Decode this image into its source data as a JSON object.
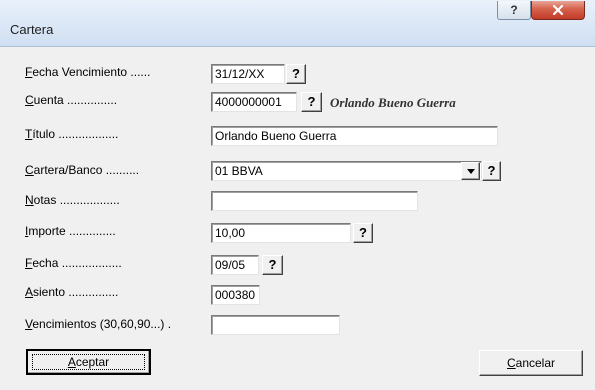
{
  "window": {
    "title": "Cartera",
    "help_glyph": "?",
    "close_glyph": "x"
  },
  "form": {
    "fecha_vencimiento": {
      "key": "F",
      "rest": "echa Vencimiento",
      "dots": " ......",
      "value": "31/12/XX"
    },
    "cuenta": {
      "key": "C",
      "rest": "uenta",
      "dots": " ...............",
      "value": "4000000001",
      "name": "Orlando Bueno Guerra"
    },
    "titulo": {
      "key": "T",
      "rest": "ítulo",
      "dots": " ..................",
      "value": "Orlando Bueno Guerra"
    },
    "cartera_banco": {
      "key": "C",
      "rest": "artera/Banco",
      "dots": " ..........",
      "value": "01 BBVA"
    },
    "notas": {
      "key": "N",
      "rest": "otas",
      "dots": " ..................",
      "value": ""
    },
    "importe": {
      "key": "I",
      "rest": "mporte",
      "dots": " ..............",
      "value": "10,00"
    },
    "fecha": {
      "key": "F",
      "rest": "echa",
      "dots": " ..................",
      "value": "09/05"
    },
    "asiento": {
      "key": "A",
      "rest": "siento",
      "dots": " ...............",
      "value": "000380"
    },
    "vencimientos": {
      "key": "V",
      "rest": "encimientos (30,60,90...)",
      "dots": " .",
      "value": ""
    }
  },
  "help_button_label": "?",
  "buttons": {
    "aceptar": {
      "key": "A",
      "rest": "ceptar"
    },
    "cancelar": {
      "key": "C",
      "rest": "ancelar"
    }
  }
}
